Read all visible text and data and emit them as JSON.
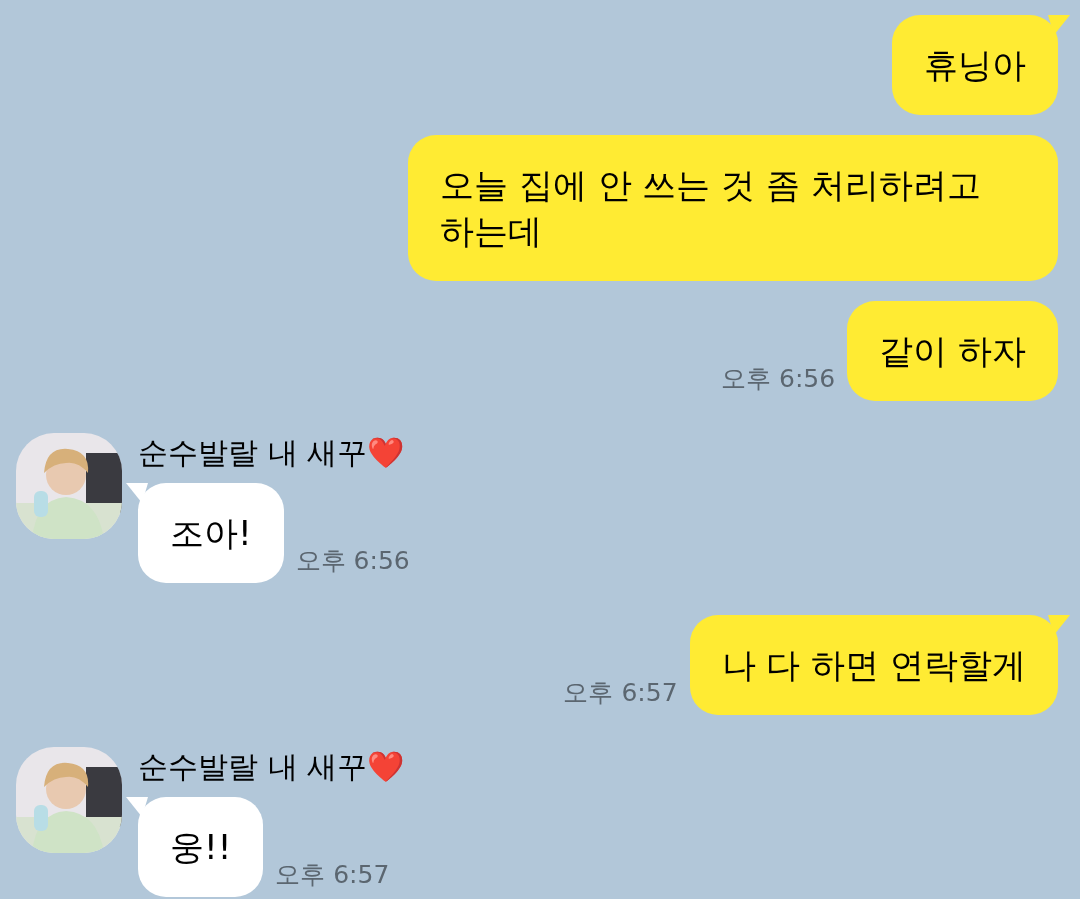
{
  "messages": [
    {
      "kind": "sent",
      "text": "휴닝아",
      "tail": true
    },
    {
      "kind": "sent",
      "text": "오늘 집에 안 쓰는 것 좀 처리하려고 하는데",
      "tail": false
    },
    {
      "kind": "sent",
      "text": "같이 하자",
      "tail": false,
      "time": "오후 6:56"
    },
    {
      "kind": "received",
      "sender": "순수발랄 내 새꾸❤️",
      "text": "조아!",
      "tail": true,
      "time": "오후 6:56"
    },
    {
      "kind": "sent",
      "text": "나 다 하면 연락할게",
      "tail": true,
      "time": "오후 6:57"
    },
    {
      "kind": "received",
      "sender": "순수발랄 내 새꾸❤️",
      "text": "웅!!",
      "tail": true,
      "time": "오후 6:57"
    }
  ]
}
